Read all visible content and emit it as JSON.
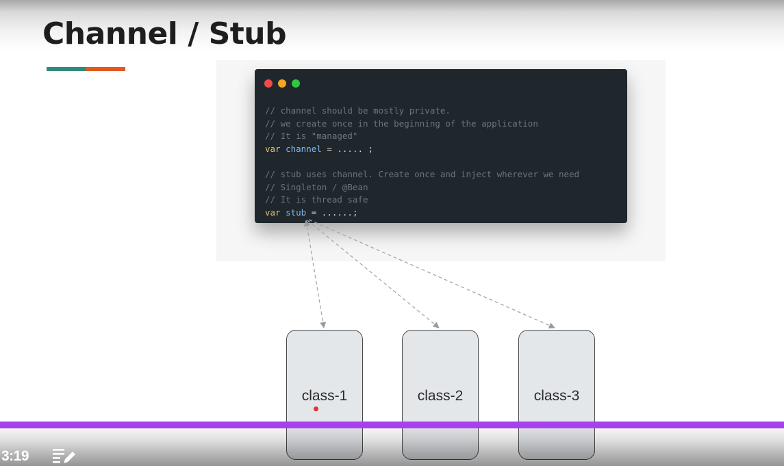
{
  "slide": {
    "title": "Channel / Stub",
    "accent_colors": [
      "#2e8b7c",
      "#e05a20"
    ]
  },
  "code_window": {
    "window_dots": [
      "#f04b4b",
      "#f5a623",
      "#2ec93f"
    ],
    "lines": [
      "// channel should be mostly private.",
      "// we create once in the beginning of the application",
      "// It is \"managed\"",
      "var channel = ..... ;",
      "",
      "// stub uses channel. Create once and inject wherever we need",
      "// Singleton / @Bean",
      "// It is thread safe",
      "var stub = ......;"
    ],
    "tokens": {
      "channel_decl": {
        "keyword": "var",
        "name": "channel",
        "rest": " = ..... ;"
      },
      "stub_decl": {
        "keyword": "var",
        "name": "stub",
        "rest": " = ......;"
      }
    }
  },
  "classes": [
    {
      "label": "class-1"
    },
    {
      "label": "class-2"
    },
    {
      "label": "class-3"
    }
  ],
  "player": {
    "timestamp": "3:19",
    "progress_color": "#a741ee",
    "playlist_icon": "playlist-edit-icon"
  }
}
